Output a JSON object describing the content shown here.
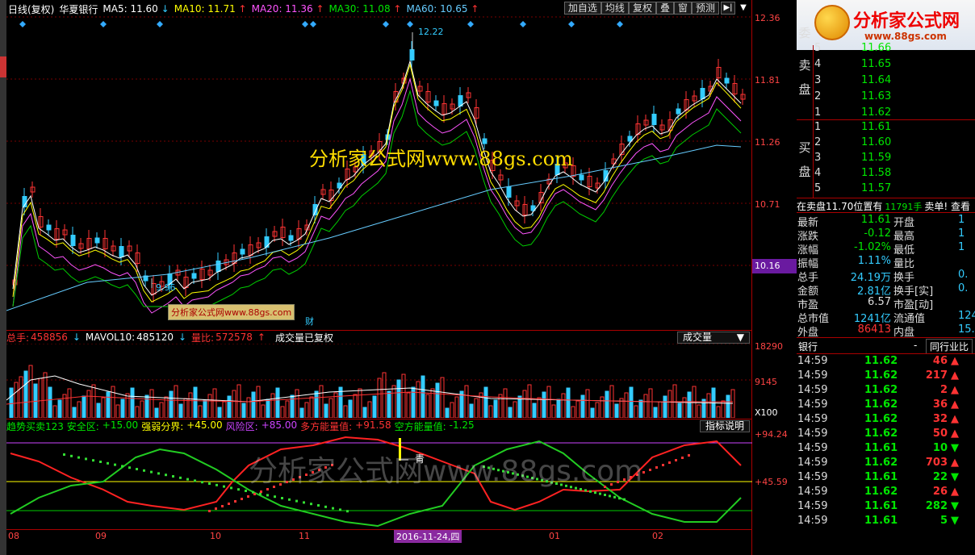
{
  "header": {
    "period": "日线(复权)",
    "stock_name": "华夏银行",
    "ma": [
      {
        "label": "MA5:",
        "value": "11.60",
        "arrow": "↓",
        "color": "#ffffff"
      },
      {
        "label": "MA10:",
        "value": "11.71",
        "arrow": "↑",
        "color": "#ffff00"
      },
      {
        "label": "MA20:",
        "value": "11.36",
        "arrow": "↑",
        "color": "#ff55ff"
      },
      {
        "label": "MA30:",
        "value": "11.08",
        "arrow": "↑",
        "color": "#00e600"
      },
      {
        "label": "MA60:",
        "value": "10.65",
        "arrow": "↑",
        "color": "#66ccff"
      }
    ]
  },
  "toolbar": [
    "加自选",
    "均线",
    "复权",
    "叠",
    "窗",
    "预测"
  ],
  "price_axis": {
    "ticks": [
      "12.36",
      "11.81",
      "11.26",
      "10.71"
    ],
    "current_price": "10.16",
    "high_label": "12.22",
    "low_label": "9.96",
    "finance_marker": "财"
  },
  "watermarks": {
    "main": "分析家公式网www.88gs.com",
    "box": "分析家公式网www.88gs.com",
    "bottom": "分析家公式网www.88gs.com"
  },
  "volume_header": {
    "total_label": "总手:",
    "total_value": "458856",
    "mavol_label": "MAVOL10:",
    "mavol_value": "485120",
    "ratio_label": "量比:",
    "ratio_value": "572578",
    "note": "成交量已复权",
    "dropdown": "成交量",
    "axis_top": "18290",
    "axis_mid": "9145",
    "axis_unit": "X100"
  },
  "indicator_header": {
    "items": [
      {
        "text": "趋势买卖123 安全区:",
        "color": "#00e600"
      },
      {
        "text": "+15.00",
        "color": "#00e600"
      },
      {
        "text": "强弱分界:",
        "color": "#ffff00"
      },
      {
        "text": "+45.00",
        "color": "#ffff00"
      },
      {
        "text": "风险区:",
        "color": "#cc44ff"
      },
      {
        "text": "+85.00",
        "color": "#cc44ff"
      },
      {
        "text": "多方能量值:",
        "color": "#ff3333"
      },
      {
        "text": "+91.58",
        "color": "#ff3333"
      },
      {
        "text": "空方能量值:",
        "color": "#00e600"
      },
      {
        "text": "-1.25",
        "color": "#00e600"
      }
    ],
    "button": "指标说明",
    "axis_top": "+94.24",
    "axis_mid": "+45.59",
    "signal_text": "青"
  },
  "date_axis": {
    "labels": [
      "08",
      "09",
      "10",
      "11",
      "01",
      "02"
    ],
    "selected": "2016-11-24,四"
  },
  "logo": {
    "main": "分析家公式网",
    "sub": "www.88gs.com"
  },
  "order_book": {
    "sell_label": "委",
    "sell_side": "卖\n盘",
    "buy_side": "买\n盘",
    "sells": [
      {
        "level": "5",
        "price": "11.66"
      },
      {
        "level": "4",
        "price": "11.65"
      },
      {
        "level": "3",
        "price": "11.64"
      },
      {
        "level": "2",
        "price": "11.63"
      },
      {
        "level": "1",
        "price": "11.62"
      }
    ],
    "buys": [
      {
        "level": "1",
        "price": "11.61"
      },
      {
        "level": "2",
        "price": "11.60"
      },
      {
        "level": "3",
        "price": "11.59"
      },
      {
        "level": "4",
        "price": "11.58"
      },
      {
        "level": "5",
        "price": "11.57"
      }
    ],
    "notice_a": "在卖盘11.70位置有",
    "notice_b": "11791手",
    "notice_c": "卖单! 查看"
  },
  "stats": [
    {
      "l1": "最新",
      "v1": "11.61",
      "c1": "#00e600",
      "l2": "开盘",
      "v2": "1"
    },
    {
      "l1": "涨跌",
      "v1": "-0.12",
      "c1": "#00e600",
      "l2": "最高",
      "v2": "1"
    },
    {
      "l1": "涨幅",
      "v1": "-1.02%",
      "c1": "#00e600",
      "l2": "最低",
      "v2": "1"
    },
    {
      "l1": "振幅",
      "v1": "1.11%",
      "c1": "#33ccff",
      "l2": "量比",
      "v2": ""
    },
    {
      "l1": "总手",
      "v1": "24.19万",
      "c1": "#33ccff",
      "l2": "换手",
      "v2": "0."
    },
    {
      "l1": "金额",
      "v1": "2.81亿",
      "c1": "#33ccff",
      "l2": "换手[实]",
      "v2": "0."
    },
    {
      "l1": "市盈",
      "v1": "6.57",
      "c1": "#dddddd",
      "l2": "市盈[动]",
      "v2": ""
    },
    {
      "l1": "总市值",
      "v1": "1241亿",
      "c1": "#33ccff",
      "l2": "流通值",
      "v2": "124"
    },
    {
      "l1": "外盘",
      "v1": "86413",
      "c1": "#ff3333",
      "l2": "内盘",
      "v2": "15.5"
    }
  ],
  "ticks_header": {
    "left": "银行",
    "mid": "-",
    "right": "同行业比"
  },
  "ticks": [
    {
      "time": "14:59",
      "price": "11.62",
      "vol": "46",
      "dir": "up"
    },
    {
      "time": "14:59",
      "price": "11.62",
      "vol": "217",
      "dir": "up"
    },
    {
      "time": "14:59",
      "price": "11.62",
      "vol": "2",
      "dir": "up"
    },
    {
      "time": "14:59",
      "price": "11.62",
      "vol": "36",
      "dir": "up"
    },
    {
      "time": "14:59",
      "price": "11.62",
      "vol": "32",
      "dir": "up"
    },
    {
      "time": "14:59",
      "price": "11.62",
      "vol": "50",
      "dir": "up"
    },
    {
      "time": "14:59",
      "price": "11.61",
      "vol": "10",
      "dir": "down"
    },
    {
      "time": "14:59",
      "price": "11.62",
      "vol": "703",
      "dir": "up"
    },
    {
      "time": "14:59",
      "price": "11.61",
      "vol": "22",
      "dir": "down"
    },
    {
      "time": "14:59",
      "price": "11.62",
      "vol": "26",
      "dir": "up"
    },
    {
      "time": "14:59",
      "price": "11.61",
      "vol": "282",
      "dir": "down"
    },
    {
      "time": "14:59",
      "price": "11.61",
      "vol": "5",
      "dir": "down"
    }
  ]
}
